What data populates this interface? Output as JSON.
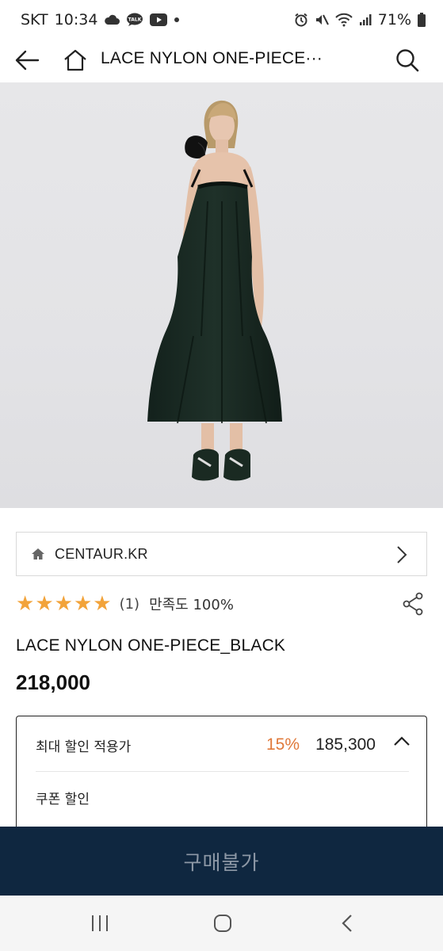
{
  "status_bar": {
    "carrier": "SKT",
    "time": "10:34",
    "battery": "71%",
    "left_icons": [
      "cloud-icon",
      "talk-icon",
      "youtube-icon",
      "dot-icon"
    ],
    "right_icons": [
      "alarm-icon",
      "mute-icon",
      "wifi-icon",
      "signal-icon",
      "battery-icon"
    ]
  },
  "header": {
    "title": "LACE NYLON ONE-PIECE···",
    "icons": [
      "back-arrow-icon",
      "home-icon",
      "search-icon"
    ]
  },
  "shop": {
    "name": "CENTAUR.KR",
    "icons": [
      "home-small-icon",
      "chevron-right-icon"
    ]
  },
  "rating": {
    "stars": 5,
    "star_color": "#f2a33a",
    "review_count": "(1)",
    "satisfaction": "만족도 100%"
  },
  "product": {
    "name": "LACE NYLON ONE-PIECE_BLACK",
    "price": "218,000"
  },
  "discount": {
    "label": "최대 할인 적용가",
    "rate": "15%",
    "rate_color": "#e0793a",
    "price": "185,300",
    "coupon_label": "쿠폰 할인"
  },
  "buy_bar": {
    "label": "구매불가",
    "background": "#0f2740"
  },
  "nav_bar": {
    "icons": [
      "recent-apps-icon",
      "home-circle-icon",
      "back-chevron-icon"
    ]
  }
}
